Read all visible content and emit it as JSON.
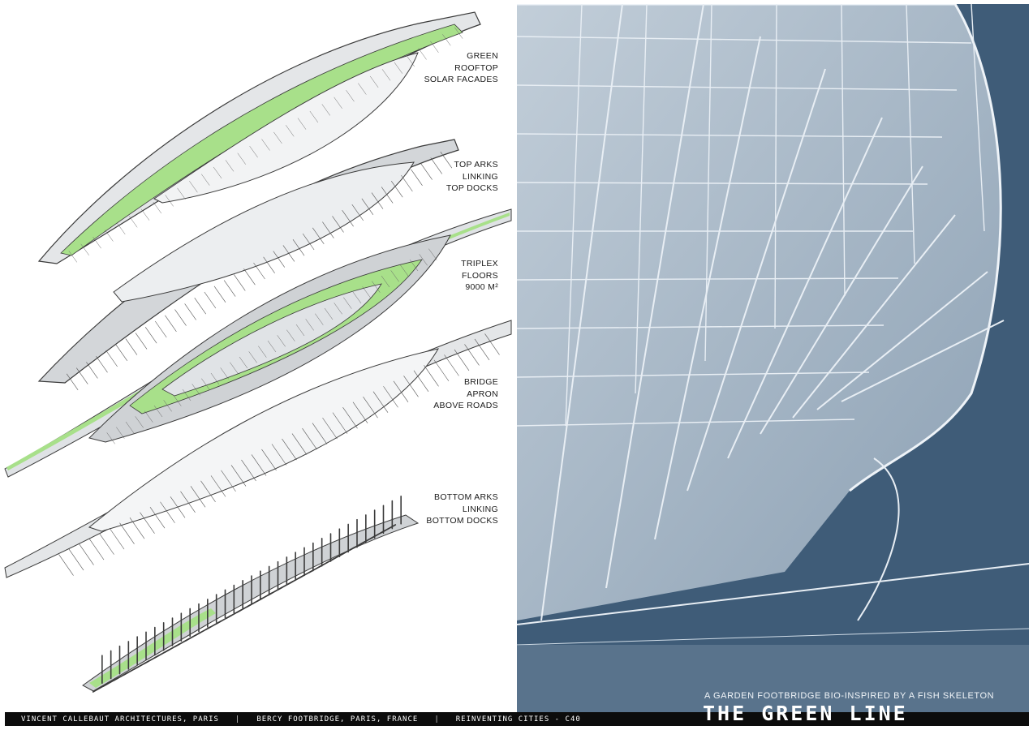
{
  "layers": [
    {
      "lines": [
        "GREEN",
        "ROOFTOP",
        "SOLAR FACADES"
      ]
    },
    {
      "lines": [
        "TOP ARKS",
        "LINKING",
        "TOP DOCKS"
      ]
    },
    {
      "lines": [
        "TRIPLEX",
        "FLOORS",
        "9000 M²"
      ]
    },
    {
      "lines": [
        "BRIDGE",
        "APRON",
        "ABOVE ROADS"
      ]
    },
    {
      "lines": [
        "BOTTOM ARKS",
        "LINKING",
        "BOTTOM DOCKS"
      ]
    }
  ],
  "subtitle": "A GARDEN FOOTBRIDGE BIO-INSPIRED BY A FISH SKELETON",
  "title": "THE GREEN LINE",
  "footer": {
    "architect": "VINCENT CALLEBAUT ARCHITECTURES, PARIS",
    "project": "BERCY FOOTBRIDGE, PARIS, FRANCE",
    "competition": "REINVENTING CITIES - C40",
    "separator": "|"
  },
  "colors": {
    "green": "#a8e08a",
    "structure": "#d9dcdf",
    "outline": "#3a3a3a",
    "render_bg": "#3f5c78",
    "render_line": "#e8eef4"
  }
}
